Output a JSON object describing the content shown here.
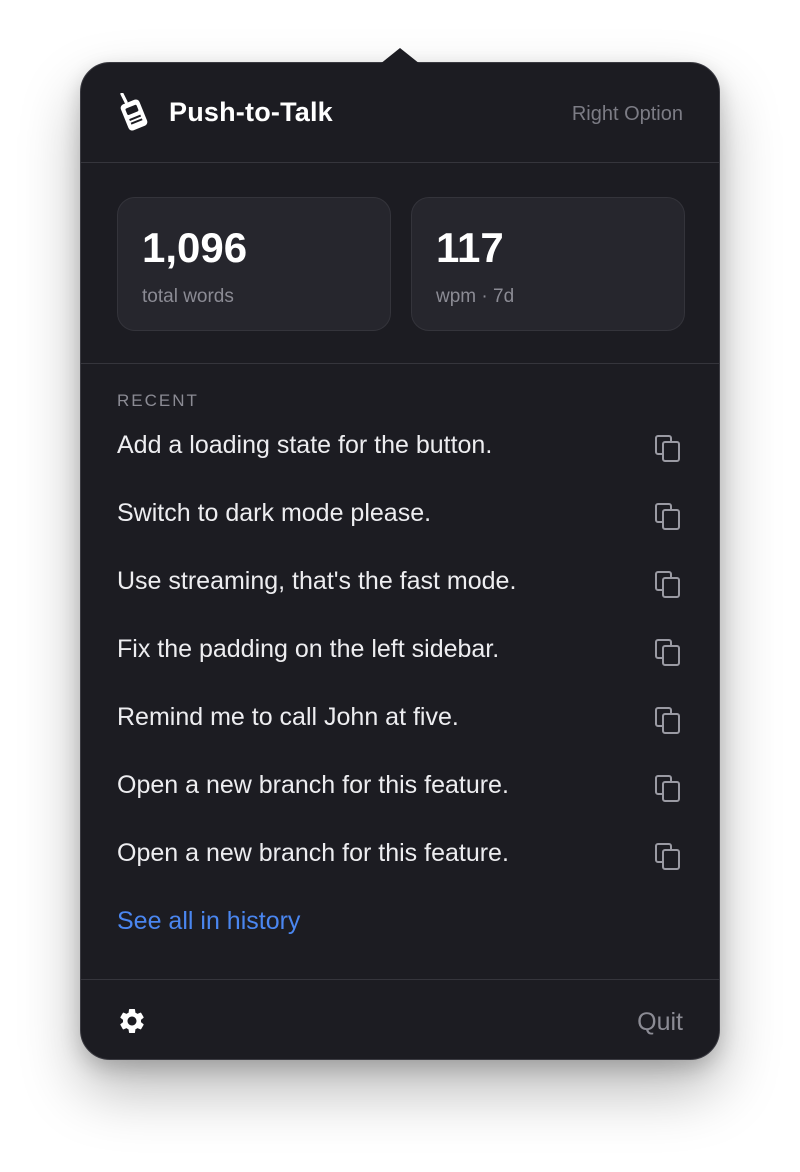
{
  "header": {
    "title": "Push-to-Talk",
    "shortcut": "Right Option",
    "icon": "walkie-talkie-icon"
  },
  "stats": [
    {
      "value": "1,096",
      "label": "total words"
    },
    {
      "value": "117",
      "label": "wpm · 7d"
    }
  ],
  "recent": {
    "label": "RECENT",
    "items": [
      {
        "text": "Add a loading state for the button."
      },
      {
        "text": "Switch to dark mode please."
      },
      {
        "text": "Use streaming, that's the fast mode."
      },
      {
        "text": "Fix the padding on the left sidebar."
      },
      {
        "text": "Remind me to call John at five."
      },
      {
        "text": "Open a new branch for this feature."
      },
      {
        "text": "Open a new branch for this feature."
      }
    ],
    "copy_icon": "copy-icon",
    "history_link": "See all in history"
  },
  "footer": {
    "settings_icon": "gear-icon",
    "quit_label": "Quit"
  },
  "colors": {
    "panel_bg": "#1c1c22",
    "card_bg": "#26262d",
    "link": "#4a86f0",
    "muted": "#8b8b94"
  }
}
